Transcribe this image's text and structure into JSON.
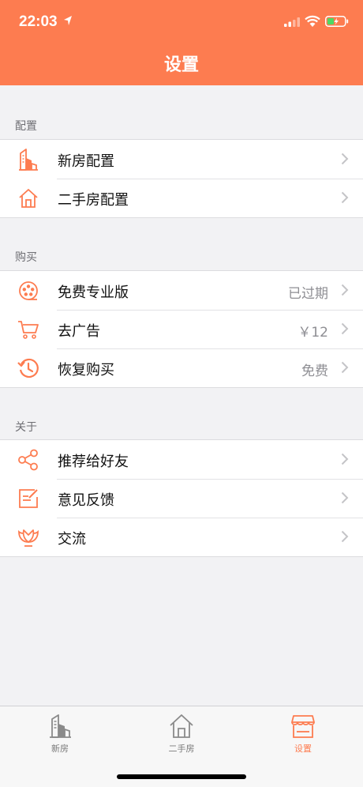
{
  "status_bar": {
    "time": "22:03"
  },
  "nav": {
    "title": "设置"
  },
  "sections": [
    {
      "header": "配置",
      "items": [
        {
          "label": "新房配置",
          "value": "",
          "icon": "building-icon"
        },
        {
          "label": "二手房配置",
          "value": "",
          "icon": "house-icon"
        }
      ]
    },
    {
      "header": "购买",
      "items": [
        {
          "label": "免费专业版",
          "value": "已过期",
          "icon": "film-reel-icon"
        },
        {
          "label": "去广告",
          "value": "￥12",
          "icon": "cart-icon"
        },
        {
          "label": "恢复购买",
          "value": "免费",
          "icon": "restore-icon"
        }
      ]
    },
    {
      "header": "关于",
      "items": [
        {
          "label": "推荐给好友",
          "value": "",
          "icon": "share-icon"
        },
        {
          "label": "意见反馈",
          "value": "",
          "icon": "feedback-icon"
        },
        {
          "label": "交流",
          "value": "",
          "icon": "lotus-icon"
        }
      ]
    }
  ],
  "tabbar": {
    "items": [
      {
        "label": "新房",
        "icon": "building-icon",
        "active": false
      },
      {
        "label": "二手房",
        "icon": "house-icon",
        "active": false
      },
      {
        "label": "设置",
        "icon": "store-icon",
        "active": true
      }
    ]
  },
  "colors": {
    "accent": "#fd7c50",
    "background": "#f2f2f4",
    "secondary_text": "#8e8e93"
  }
}
